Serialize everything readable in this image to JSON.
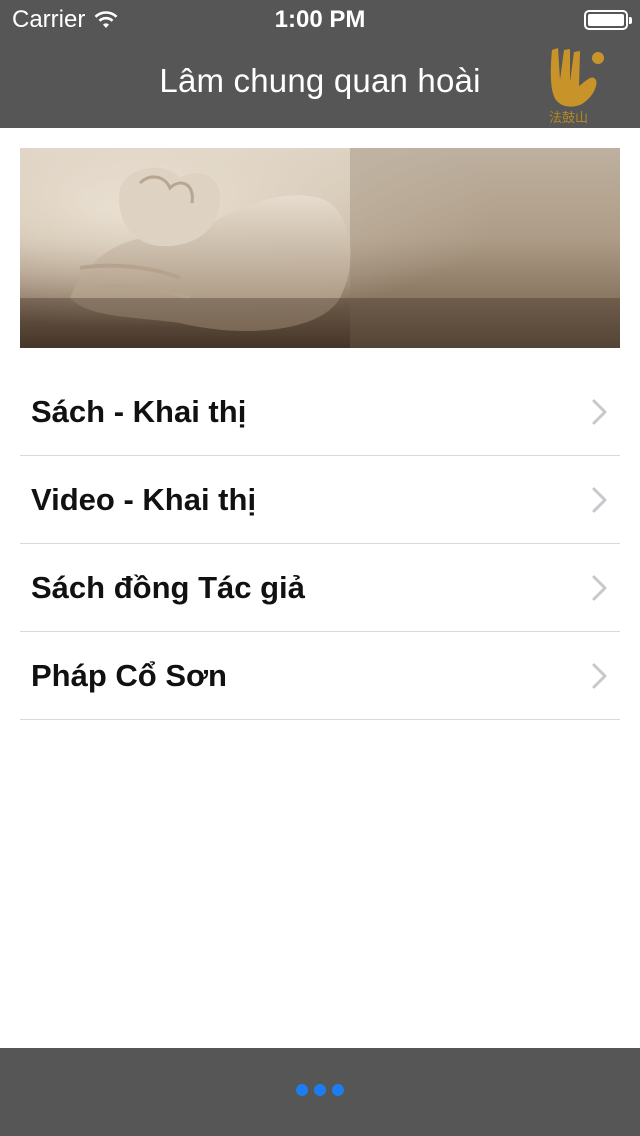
{
  "status_bar": {
    "carrier": "Carrier",
    "time": "1:00 PM"
  },
  "nav": {
    "title": "Lâm chung quan hoài"
  },
  "banner": {
    "icon": "lotus-hands-photo"
  },
  "list": {
    "items": [
      {
        "label": "Sách -  Khai thị"
      },
      {
        "label": "Video - Khai thị"
      },
      {
        "label": "Sách đồng Tác giả"
      },
      {
        "label": "Pháp Cổ Sơn"
      }
    ]
  },
  "colors": {
    "bar": "#565656",
    "dot": "#1a7df2",
    "logo": "#c8942a",
    "text": "#111111"
  },
  "bottom_bar": {
    "icon": "more-dots-icon"
  }
}
